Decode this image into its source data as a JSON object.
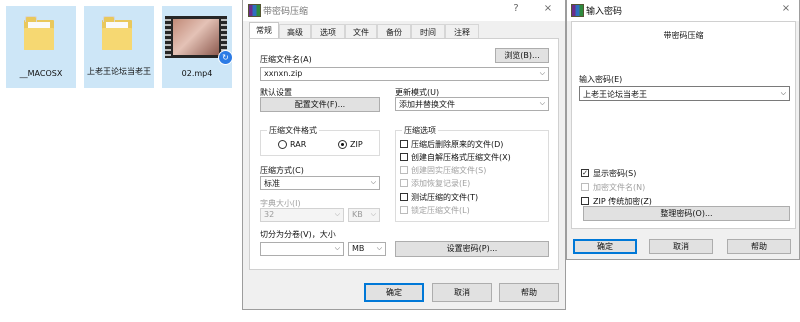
{
  "desktop": {
    "files": [
      {
        "name": "__MACOSX",
        "type": "folder"
      },
      {
        "name": "上老王论坛当老王",
        "type": "folder"
      },
      {
        "name": "02.mp4",
        "type": "video"
      }
    ]
  },
  "archive_dialog": {
    "title": "带密码压缩",
    "help_glyph": "?",
    "close_glyph": "×",
    "tabs": [
      "常规",
      "高级",
      "选项",
      "文件",
      "备份",
      "时间",
      "注释"
    ],
    "archive_name_label": "压缩文件名(A)",
    "browse_label": "浏览(B)...",
    "archive_name_value": "xxnxn.zip",
    "default_settings_label": "默认设置",
    "profiles_button": "配置文件(F)...",
    "update_mode_label": "更新模式(U)",
    "update_mode_value": "添加并替换文件",
    "format_group_title": "压缩文件格式",
    "format_options": [
      {
        "label": "RAR",
        "selected": false
      },
      {
        "label": "ZIP",
        "selected": true
      }
    ],
    "options_group_title": "压缩选项",
    "options": [
      {
        "label": "压缩后删除原来的文件(D)",
        "checked": false,
        "enabled": true
      },
      {
        "label": "创建自解压格式压缩文件(X)",
        "checked": false,
        "enabled": true
      },
      {
        "label": "创建固实压缩文件(S)",
        "checked": false,
        "enabled": false
      },
      {
        "label": "添加恢复记录(E)",
        "checked": false,
        "enabled": false
      },
      {
        "label": "测试压缩的文件(T)",
        "checked": false,
        "enabled": true
      },
      {
        "label": "锁定压缩文件(L)",
        "checked": false,
        "enabled": false
      }
    ],
    "method_label": "压缩方式(C)",
    "method_value": "标准",
    "dict_size_label": "字典大小(I)",
    "dict_size_value": "32",
    "dict_unit_value": "KB",
    "split_label": "切分为分卷(V)，大小",
    "split_value": "",
    "split_unit_value": "MB",
    "set_password_button": "设置密码(P)...",
    "ok_button": "确定",
    "cancel_button": "取消",
    "help_button": "帮助"
  },
  "password_dialog": {
    "title": "输入密码",
    "close_glyph": "×",
    "subtitle": "带密码压缩",
    "enter_password_label": "输入密码(E)",
    "password_value": "上老王论坛当老王",
    "checks": [
      {
        "label": "显示密码(S)",
        "checked": true,
        "enabled": true
      },
      {
        "label": "加密文件名(N)",
        "checked": false,
        "enabled": false
      },
      {
        "label": "ZIP 传统加密(Z)",
        "checked": false,
        "enabled": true
      }
    ],
    "organize_button": "整理密码(O)...",
    "ok_button": "确定",
    "cancel_button": "取消",
    "help_button": "帮助"
  },
  "colors": {
    "selection": "#cde6f7",
    "accent": "#0078d7",
    "dialog_bg": "#f0f0f0"
  }
}
